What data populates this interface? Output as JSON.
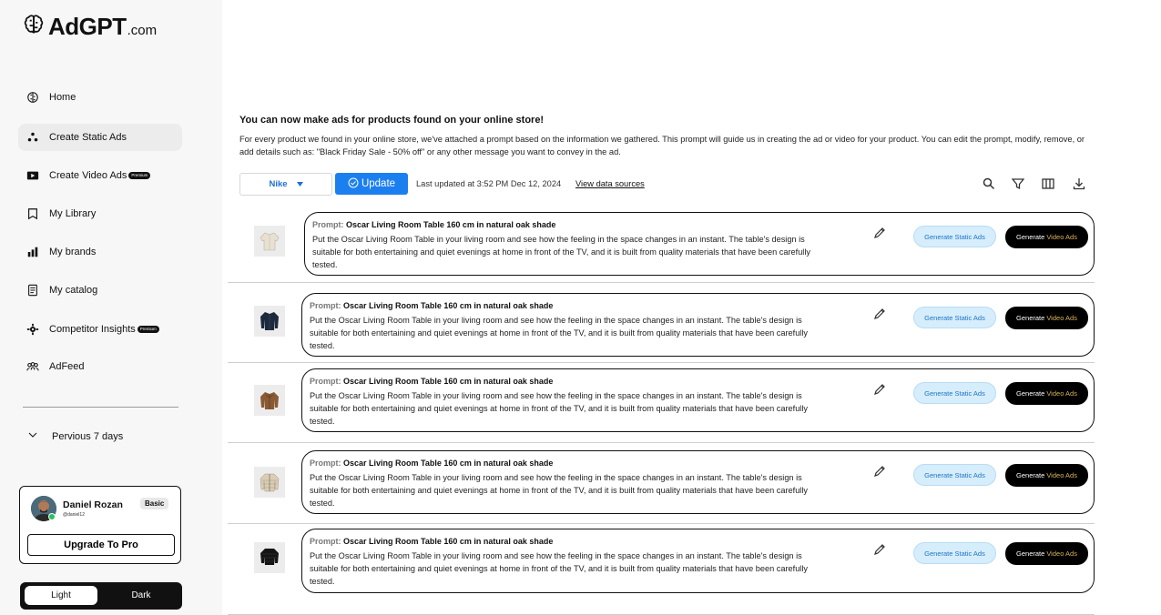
{
  "app": {
    "logo_main": "AdGPT",
    "logo_suffix": ".com"
  },
  "sidebar": {
    "items": [
      {
        "label": "Home",
        "icon": "brain-icon"
      },
      {
        "label": "Create Static Ads",
        "icon": "dots-icon",
        "active": true
      },
      {
        "label": "Create Video Ads",
        "icon": "video-icon",
        "badge": "Premium"
      },
      {
        "label": "My Library",
        "icon": "library-icon"
      },
      {
        "label": "My brands",
        "icon": "brands-icon"
      },
      {
        "label": "My catalog",
        "icon": "catalog-icon"
      },
      {
        "label": "Competitor Insights",
        "icon": "gear-icon",
        "badge": "Premium"
      },
      {
        "label": "AdFeed",
        "icon": "people-icon"
      }
    ],
    "previous": "Pervious 7 days"
  },
  "profile": {
    "name": "Daniel Rozan",
    "handle": "@daniel12",
    "plan": "Basic",
    "upgrade_label": "Upgrade To Pro"
  },
  "theme": {
    "light": "Light",
    "dark": "Dark"
  },
  "main": {
    "headline": "You can now make ads for products found on your online store!",
    "description": "For every product we found in your online store, we've attached a prompt based on the information we gathered. This prompt will guide us in creating the ad or video for your product. You can edit the prompt, modify, remove, or add details such as: \"Black Friday Sale - 50% off\" or any other message you want to convey in the ad.",
    "brand_selected": "Nike",
    "update_label": "Update",
    "last_updated": "Last updated at 3:52 PM Dec 12, 2024",
    "sources_label": "View data sources"
  },
  "buttons": {
    "static": "Generate Static Ads",
    "video_prefix": "Generate",
    "video_suffix": "Video Ads"
  },
  "products": [
    {
      "prompt_label": "Prompt:",
      "title": "Oscar Living Room Table 160 cm in natural oak shade",
      "body": "Put the Oscar Living Room Table in your living room and see how the feeling in the space changes in an instant. The table's design is suitable for both entertaining and quiet evenings at home in front of the TV, and it is built from quality materials that have been carefully tested.",
      "thumb": "cream-jacket"
    },
    {
      "prompt_label": "Prompt:",
      "title": "Oscar Living Room Table 160 cm in natural oak shade",
      "body": "Put the Oscar Living Room Table in your living room and see how the feeling in the space changes in an instant. The table's design is suitable for both entertaining and quiet evenings at home in front of the TV, and it is built from quality materials that have been carefully tested.",
      "thumb": "navy-jacket"
    },
    {
      "prompt_label": "Prompt:",
      "title": "Oscar Living Room Table 160 cm in natural oak shade",
      "body": "Put the Oscar Living Room Table in your living room and see how the feeling in the space changes in an instant. The table's design is suitable for both entertaining and quiet evenings at home in front of the TV, and it is built from quality materials that have been carefully tested.",
      "thumb": "brown-jacket"
    },
    {
      "prompt_label": "Prompt:",
      "title": "Oscar Living Room Table 160 cm in natural oak shade",
      "body": "Put the Oscar Living Room Table in your living room and see how the feeling in the space changes in an instant. The table's design is suitable for both entertaining and quiet evenings at home in front of the TV, and it is built from quality materials that have been carefully tested.",
      "thumb": "beige-puffer"
    },
    {
      "prompt_label": "Prompt:",
      "title": "Oscar Living Room Table 160 cm in natural oak shade",
      "body": "Put the Oscar Living Room Table in your living room and see how the feeling in the space changes in an instant. The table's design is suitable for both entertaining and quiet evenings at home in front of the TV, and it is built from quality materials that have been carefully tested.",
      "thumb": "black-puffer"
    }
  ],
  "colors": {
    "accent": "#1c7ff0",
    "static_button_bg": "#d6edfb",
    "video_button_bg": "#000000",
    "video_gold": "#d8b25a"
  }
}
